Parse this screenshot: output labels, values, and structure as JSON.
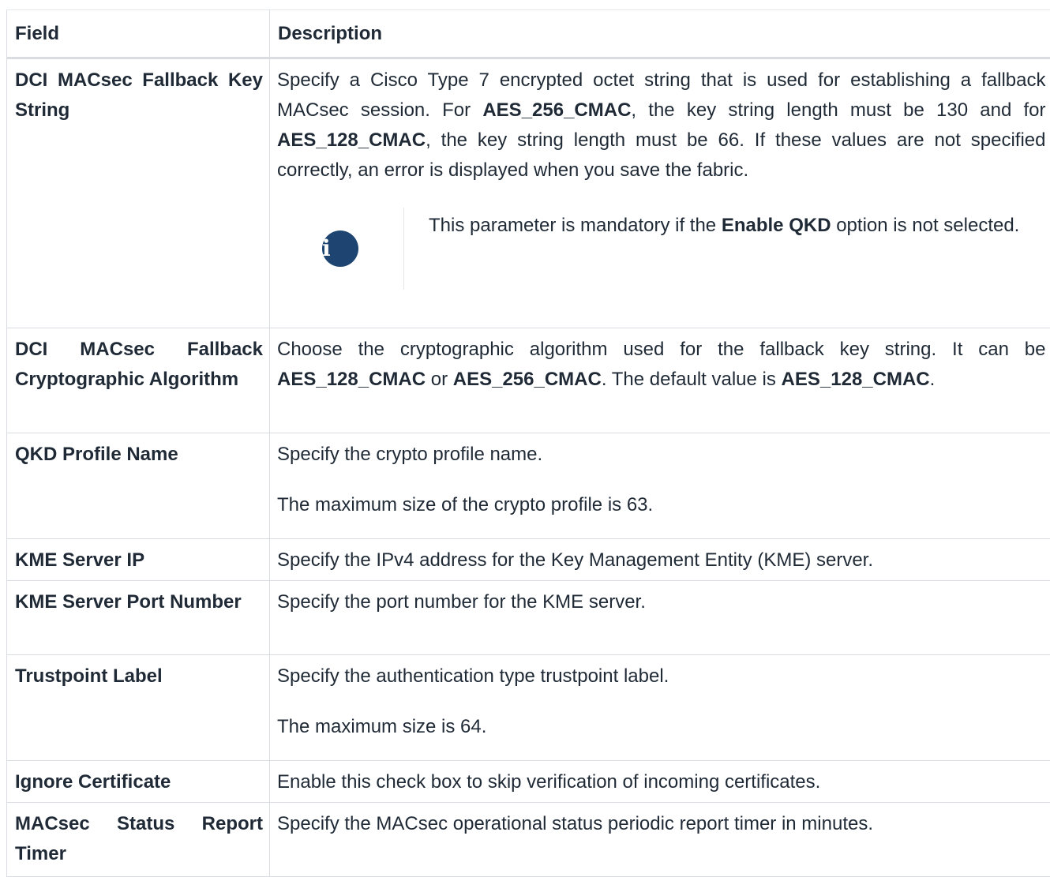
{
  "table": {
    "headers": [
      "Field",
      "Description"
    ],
    "rows": [
      {
        "field": "DCI MACsec Fallback Key String",
        "desc": [
          {
            "t": "Specify a Cisco Type 7 encrypted octet string that is used for establishing a fallback MACsec session. For "
          },
          {
            "t": "AES_256_CMAC",
            "b": true
          },
          {
            "t": ", the key string length must be 130 and for "
          },
          {
            "t": "AES_128_CMAC",
            "b": true
          },
          {
            "t": ", the key string length must be 66. If these values are not specified correctly, an error is displayed when you save the fabric."
          }
        ],
        "note": {
          "icon": "info-icon",
          "parts": [
            {
              "t": "This parameter is mandatory if the "
            },
            {
              "t": "Enable QKD",
              "b": true
            },
            {
              "t": " option is not selected."
            }
          ]
        }
      },
      {
        "field": "DCI MACsec Fallback Cryptographic Algorithm",
        "desc": [
          {
            "t": "Choose the cryptographic algorithm used for the fallback key string. It can be "
          },
          {
            "t": "AES_128_CMAC",
            "b": true
          },
          {
            "t": " or "
          },
          {
            "t": "AES_256_CMAC",
            "b": true
          },
          {
            "t": ". The default value is "
          },
          {
            "t": "AES_128_CMAC",
            "b": true
          },
          {
            "t": "."
          }
        ]
      },
      {
        "field": "QKD Profile Name",
        "desc": [
          {
            "t": "Specify the crypto profile name."
          }
        ],
        "desc2": [
          {
            "t": "The maximum size of the crypto profile is 63."
          }
        ]
      },
      {
        "field": "KME Server IP",
        "desc": [
          {
            "t": "Specify the IPv4 address for the Key Management Entity (KME) server."
          }
        ]
      },
      {
        "field": "KME Server Port Number",
        "desc": [
          {
            "t": "Specify the port number for the KME server."
          }
        ]
      },
      {
        "field": "Trustpoint Label",
        "desc": [
          {
            "t": "Specify the authentication type trustpoint label."
          }
        ],
        "desc2": [
          {
            "t": "The maximum size is 64."
          }
        ]
      },
      {
        "field": "Ignore Certificate",
        "desc": [
          {
            "t": "Enable this check box to skip verification of incoming certificates."
          }
        ]
      },
      {
        "field": "MACsec Status Report Timer",
        "desc": [
          {
            "t": "Specify the MACsec operational status periodic report timer in minutes."
          }
        ]
      }
    ]
  }
}
